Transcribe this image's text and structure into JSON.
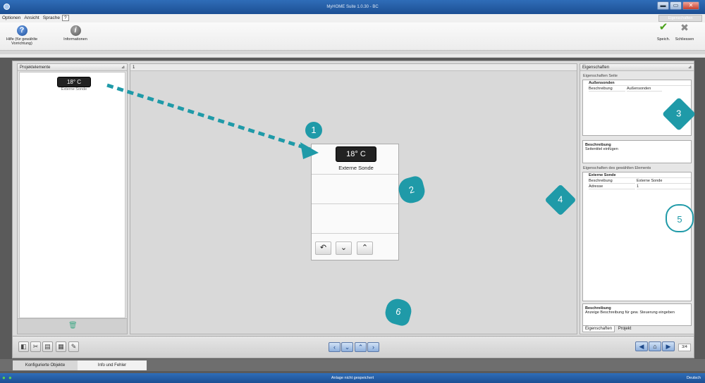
{
  "window": {
    "title": "MyHOME Suite 1.0.30 - BC",
    "min": "▬",
    "max": "▭",
    "close": "✕"
  },
  "menu": {
    "optionen": "Optionen",
    "ansicht": "Ansicht",
    "sprache": "Sprache",
    "help_q": "?",
    "tab_label": "Eigenschaften"
  },
  "ribbon": {
    "hilfe": "Hilfe (für gewählte Vorrichtung)",
    "info": "Informationen",
    "speich": "Speich.",
    "schliessen": "Schliessen",
    "hilfe_icon": "?",
    "info_icon": "i",
    "save_icon": "✔",
    "close_icon": "✖"
  },
  "left_panel": {
    "title": "Projektelemente",
    "pin": "⊿",
    "sensor_value": "18° C",
    "sensor_label": "Externe Sonde",
    "trash": "🗑"
  },
  "center": {
    "page_number": "1"
  },
  "device": {
    "sensor_value": "18° C",
    "sensor_label": "Externe Sonde",
    "btn_back": "↶",
    "btn_down": "⌄",
    "btn_up": "⌃"
  },
  "right_panel": {
    "title": "Eigenschaften",
    "pin": "⊿",
    "page_props": "Eigenschaften Seite",
    "page_group": "Außensonden",
    "page_key": "Beschreibung",
    "page_val": "Außensonden",
    "desc1_title": "Beschreibung",
    "desc1_text": "Seitentitel einfügen",
    "elem_props": "Eigenschaften des gewählten Elements",
    "elem_group": "Externe Sonde",
    "elem_key1": "Beschreibung",
    "elem_val1": "Externe Sonde",
    "elem_key2": "Adresse",
    "elem_val2": "1",
    "desc2_title": "Beschreibung",
    "desc2_text": "Anzeige Beschreibung für gew. Steuerung eingeben",
    "tab_props": "Eigenschaften",
    "tab_projekt": "Projekt"
  },
  "bottombar": {
    "tools": [
      "◧",
      "✂",
      "▤",
      "▦",
      "✎"
    ],
    "nav": [
      "‹",
      "⌄",
      "⌃",
      "›"
    ],
    "back": "◀",
    "home": "⌂",
    "forward": "▶",
    "page_indicator": "3/4"
  },
  "lowtabs": {
    "tab1": "Konfigurierte Objekte",
    "tab2": "Info und Fehler"
  },
  "status": {
    "message": "Anlage nicht gespeichert",
    "language": "Deutsch",
    "ok_icon": "●"
  },
  "markers": {
    "m1": "1",
    "m2": "2",
    "m3": "3",
    "m4": "4",
    "m5": "5",
    "m6": "6"
  },
  "colors": {
    "accent": "#1f9aa8",
    "titlebar": "#1c4f93"
  }
}
